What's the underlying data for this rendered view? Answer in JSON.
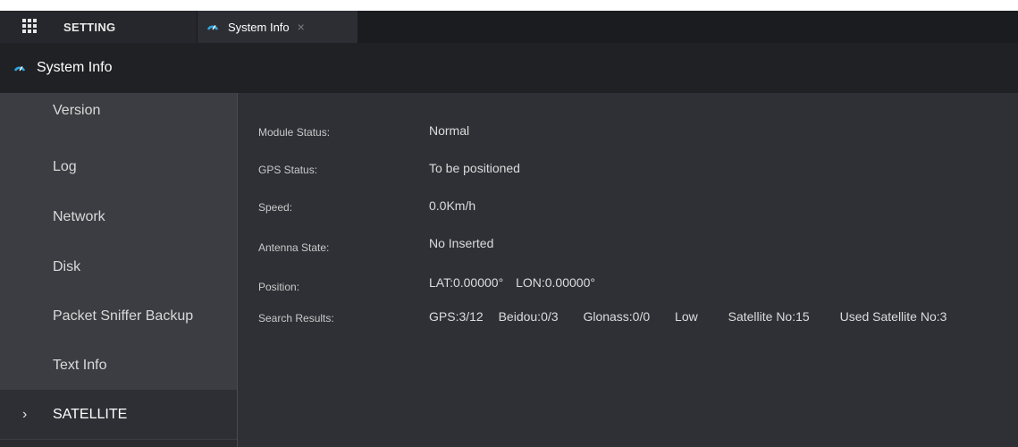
{
  "tabs": {
    "setting_label": "SETTING",
    "sysinfo_label": "System Info",
    "close_glyph": "×"
  },
  "title": "System Info",
  "sidebar": {
    "items": [
      {
        "label": "Version"
      },
      {
        "label": "Log"
      },
      {
        "label": "Network"
      },
      {
        "label": "Disk"
      },
      {
        "label": "Packet Sniffer Backup"
      },
      {
        "label": "Text Info"
      },
      {
        "label": "SATELLITE",
        "active": true
      }
    ]
  },
  "info": {
    "module_status_label": "Module Status:",
    "module_status_value": "Normal",
    "gps_status_label": "GPS Status:",
    "gps_status_value": "To be positioned",
    "speed_label": "Speed:",
    "speed_value": "0.0Km/h",
    "antenna_label": "Antenna State:",
    "antenna_value": "No Inserted",
    "position_label": "Position:",
    "position_lat": "LAT:0.00000°",
    "position_lon": "LON:0.00000°",
    "search_label": "Search Results:",
    "search_gps": "GPS:3/12",
    "search_beidou": "Beidou:0/3",
    "search_glonass": "Glonass:0/0",
    "search_level": "Low",
    "search_satellite_no": "Satellite No:15",
    "search_used_satellite_no": "Used Satellite No:3"
  },
  "colors": {
    "accent_icon": "#2fa8e0",
    "background_dark": "#202125",
    "sidebar_bg": "#3c3d42",
    "main_bg": "#2f3036"
  },
  "icons": {
    "menu": "grid-icon",
    "system_info": "gauge-icon",
    "close": "close-icon",
    "chevron": "chevron-right-icon"
  }
}
